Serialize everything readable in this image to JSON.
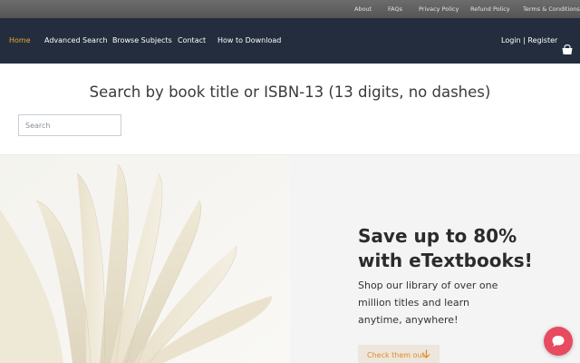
{
  "topbar": {
    "links": [
      "About",
      "FAQs",
      "Privacy Policy",
      "Refund Policy",
      "Terms & Conditions"
    ]
  },
  "navbar": {
    "items": [
      "Home",
      "Advanced Search",
      "Browse Subjects",
      "Contact",
      "How to Download"
    ],
    "active": "Home",
    "login_label": "Login | Register",
    "cart_icon": "shopping-bag-icon"
  },
  "search": {
    "heading": "Search by book title or ISBN-13 (13 digits, no dashes)",
    "placeholder": "Search"
  },
  "hero": {
    "title_lines": [
      "Save up to 80%",
      "with eTextbooks!"
    ],
    "subtitle_lines": [
      "Shop our library of over one",
      "million titles and learn",
      "anytime, anywhere!"
    ],
    "cta_label": "Check them out",
    "cta_icon": "arrow-down-icon"
  },
  "chat": {
    "icon": "chat-bubble-icon"
  },
  "colors": {
    "topbar_bg": "#5f5f5f",
    "nav_bg": "#232d3d",
    "accent": "#f0a53b",
    "chat": "#e84a5f"
  }
}
